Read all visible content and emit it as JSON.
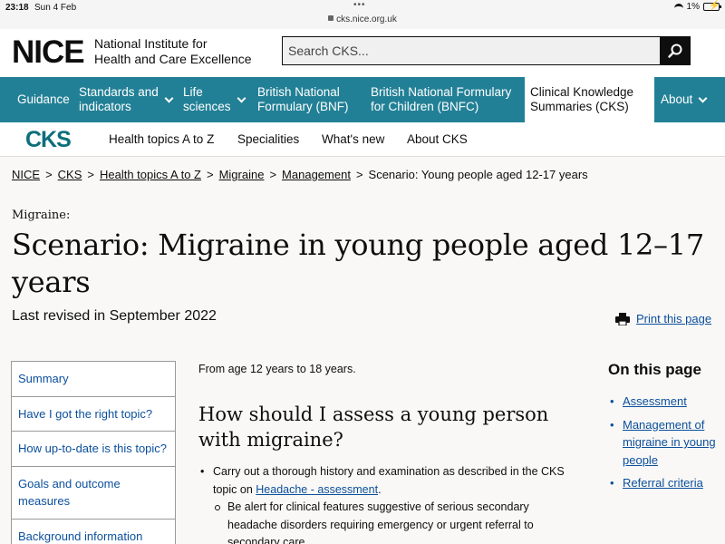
{
  "status_bar": {
    "time": "23:18",
    "date": "Sun 4 Feb",
    "url": "cks.nice.org.uk",
    "battery": "1%"
  },
  "header": {
    "logo": "NICE",
    "org_line1": "National Institute for",
    "org_line2": "Health and Care Excellence",
    "search_placeholder": "Search CKS..."
  },
  "nav": {
    "items": [
      {
        "label": "Guidance"
      },
      {
        "label_line1": "Standards and",
        "label_line2": "indicators"
      },
      {
        "label_line1": "Life",
        "label_line2": "sciences"
      },
      {
        "label_line1": "British National",
        "label_line2": "Formulary (BNF)"
      },
      {
        "label_line1": "British National Formulary",
        "label_line2": "for Children (BNFC)"
      },
      {
        "label_line1": "Clinical Knowledge",
        "label_line2": "Summaries (CKS)"
      },
      {
        "label": "About"
      }
    ]
  },
  "cks_nav": {
    "logo": "CKS",
    "links": [
      "Health topics A to Z",
      "Specialities",
      "What's new",
      "About CKS"
    ]
  },
  "breadcrumb": [
    "NICE",
    "CKS",
    "Health topics A to Z",
    "Migraine",
    "Management",
    "Scenario: Young people aged 12-17 years"
  ],
  "page": {
    "eyebrow": "Migraine:",
    "title": "Scenario: Migraine in young people aged 12–17 years",
    "revised": "Last revised in September 2022",
    "print_label": "Print this page"
  },
  "side_menu": [
    "Summary",
    "Have I got the right topic?",
    "How up-to-date is this topic?",
    "Goals and outcome measures",
    "Background information"
  ],
  "content": {
    "intro": "From age 12 years to 18 years.",
    "heading": "How should I assess a young person with migraine?",
    "bullet1_text": "Carry out a thorough history and examination as described in the CKS topic on ",
    "bullet1_link": "Headache - assessment",
    "bullet1_end": ".",
    "sub1": "Be alert for clinical features suggestive of serious secondary headache disorders requiring emergency or urgent referral to secondary care."
  },
  "on_this_page": {
    "title": "On this page",
    "items": [
      "Assessment",
      "Management of migraine in young people",
      "Referral criteria"
    ]
  },
  "colors": {
    "nav_teal": "#228096",
    "link_blue": "#0b4f9c",
    "cks_logo": "#0e6f7a"
  }
}
